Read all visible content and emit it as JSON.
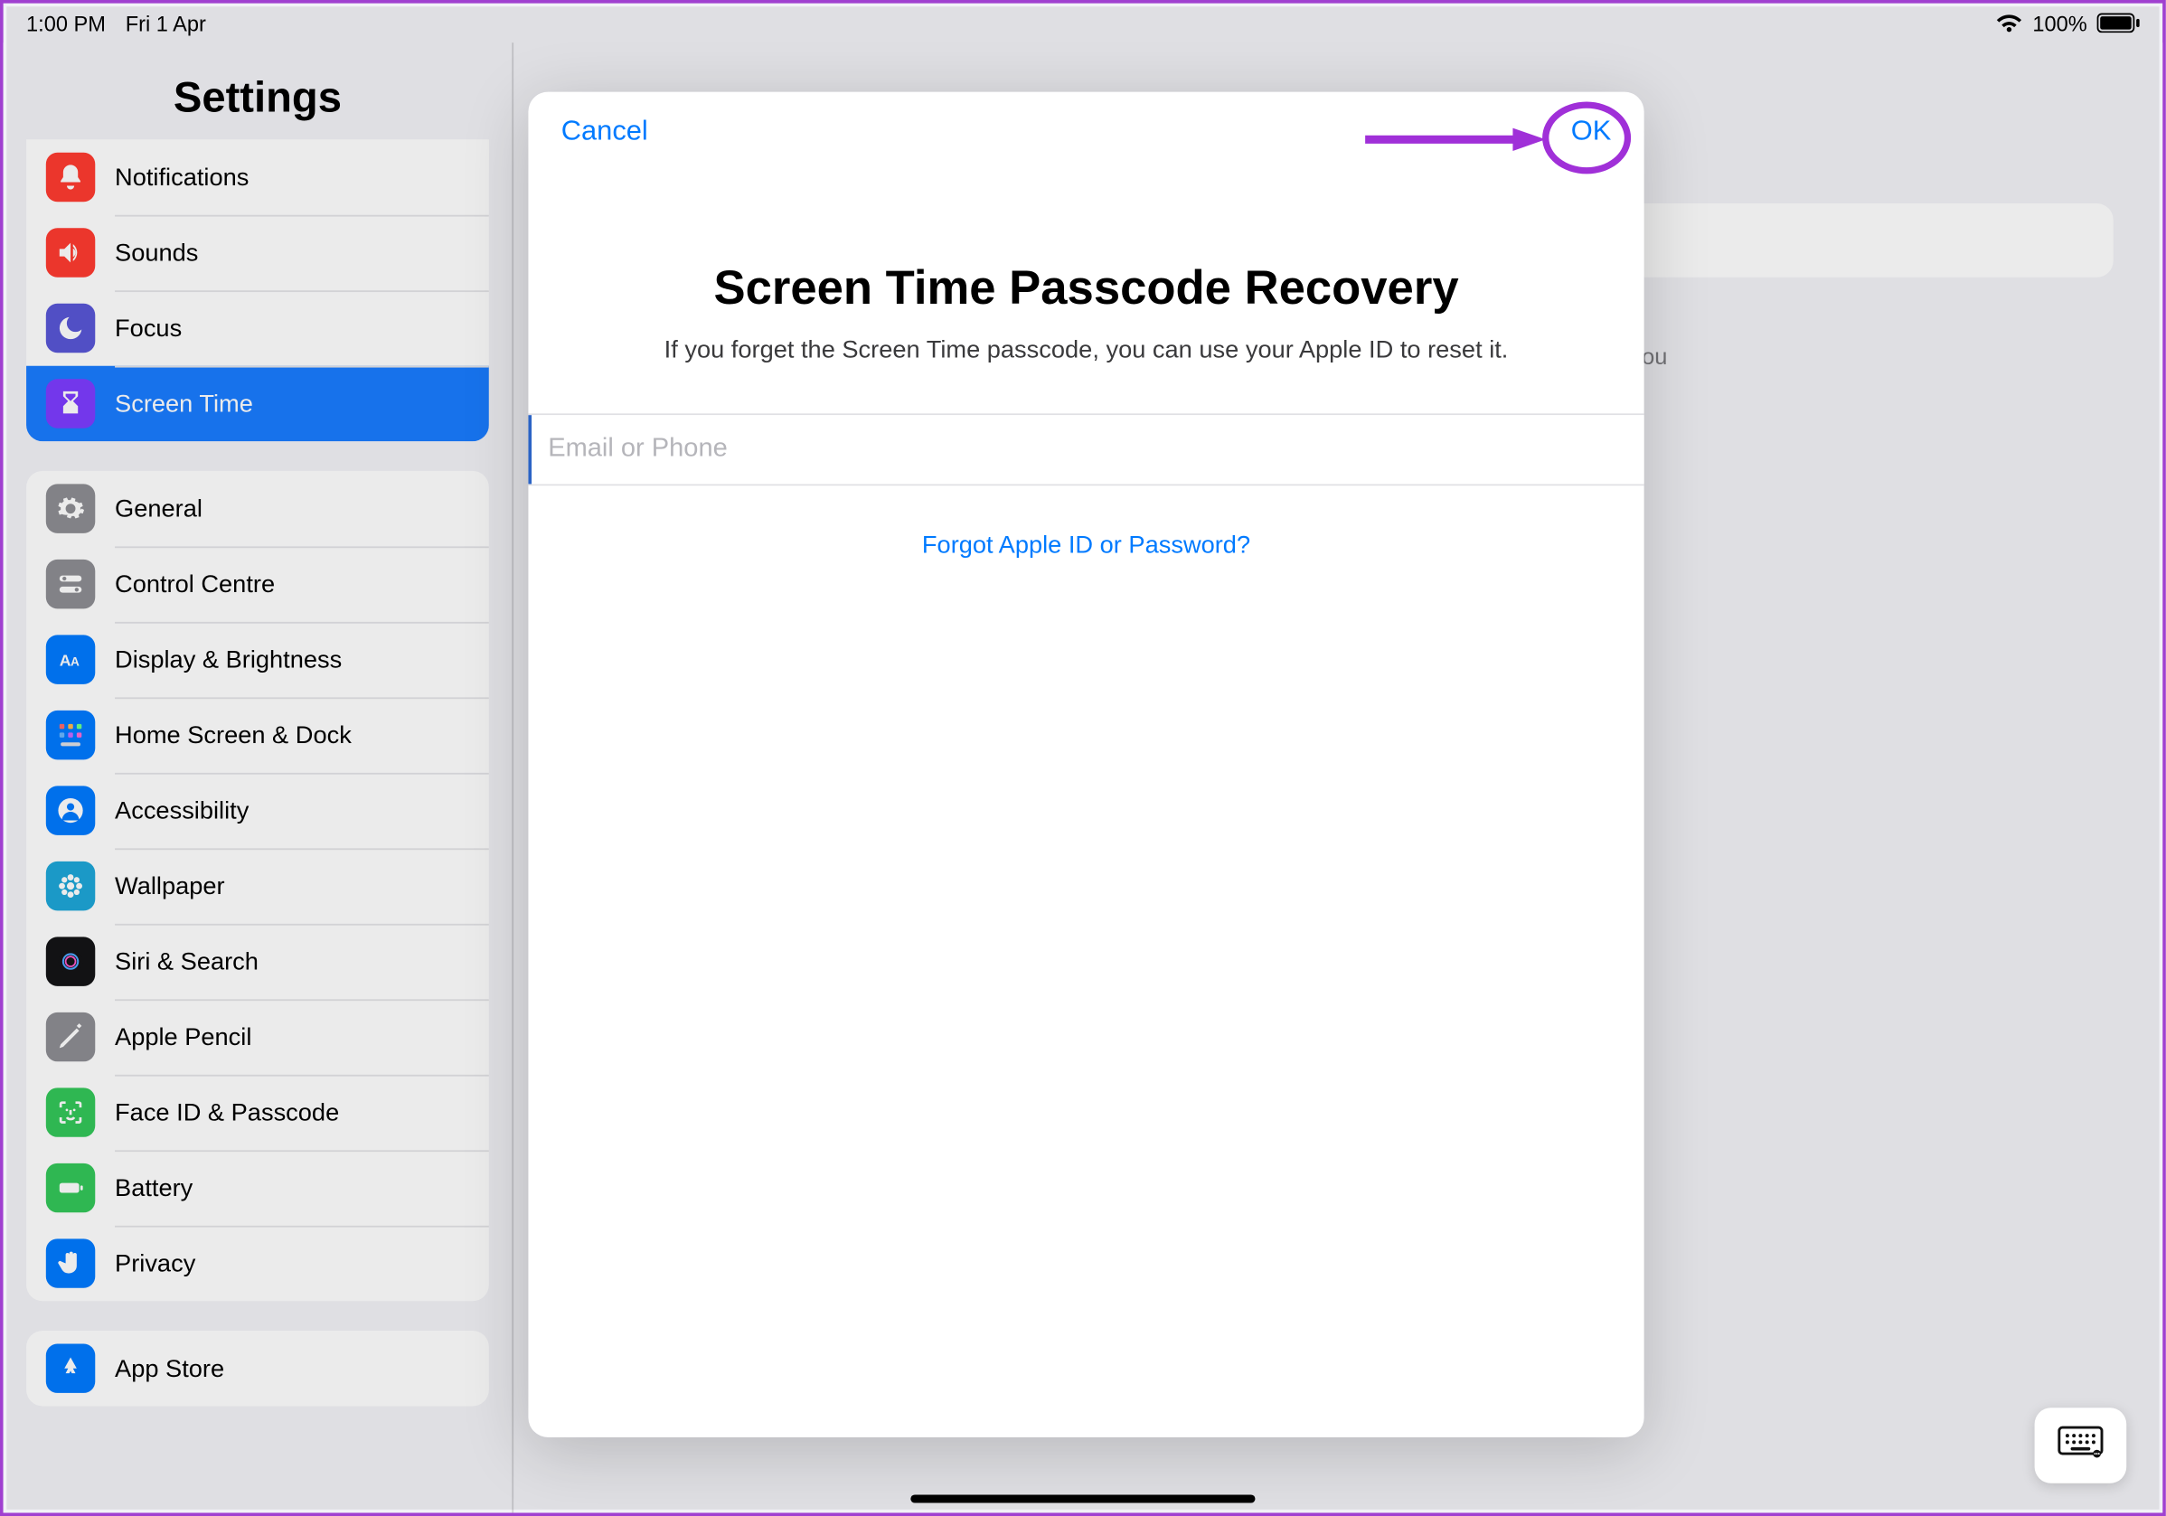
{
  "status": {
    "time": "1:00 PM",
    "date": "Fri 1 Apr",
    "battery_pct": "100%"
  },
  "sidebar": {
    "title": "Settings",
    "group1": [
      {
        "label": "Notifications",
        "icon": "bell-icon",
        "bg": "bg-red"
      },
      {
        "label": "Sounds",
        "icon": "speaker-icon",
        "bg": "bg-red"
      },
      {
        "label": "Focus",
        "icon": "moon-icon",
        "bg": "bg-purple"
      },
      {
        "label": "Screen Time",
        "icon": "hourglass-icon",
        "bg": "bg-violet"
      }
    ],
    "group2": [
      {
        "label": "General",
        "icon": "gear-icon",
        "bg": "bg-grey"
      },
      {
        "label": "Control Centre",
        "icon": "switches-icon",
        "bg": "bg-grey"
      },
      {
        "label": "Display & Brightness",
        "icon": "aa-icon",
        "bg": "bg-blue"
      },
      {
        "label": "Home Screen & Dock",
        "icon": "grid-icon",
        "bg": "bg-blue"
      },
      {
        "label": "Accessibility",
        "icon": "person-icon",
        "bg": "bg-blue"
      },
      {
        "label": "Wallpaper",
        "icon": "flower-icon",
        "bg": "bg-lblue"
      },
      {
        "label": "Siri & Search",
        "icon": "siri-icon",
        "bg": "bg-black"
      },
      {
        "label": "Apple Pencil",
        "icon": "pencil-icon",
        "bg": "bg-grey"
      },
      {
        "label": "Face ID & Passcode",
        "icon": "faceid-icon",
        "bg": "bg-green"
      },
      {
        "label": "Battery",
        "icon": "battery-icon",
        "bg": "bg-green"
      },
      {
        "label": "Privacy",
        "icon": "hand-icon",
        "bg": "bg-blue"
      }
    ],
    "group3": [
      {
        "label": "App Store",
        "icon": "appstore-icon",
        "bg": "bg-blue"
      }
    ]
  },
  "detail": {
    "hint_fragment": "time limits for apps you"
  },
  "modal": {
    "cancel": "Cancel",
    "ok": "OK",
    "title": "Screen Time Passcode Recovery",
    "subtitle": "If you forget the Screen Time passcode, you can use your Apple ID to reset it.",
    "placeholder": "Email or Phone",
    "forgot": "Forgot Apple ID or Password?"
  }
}
